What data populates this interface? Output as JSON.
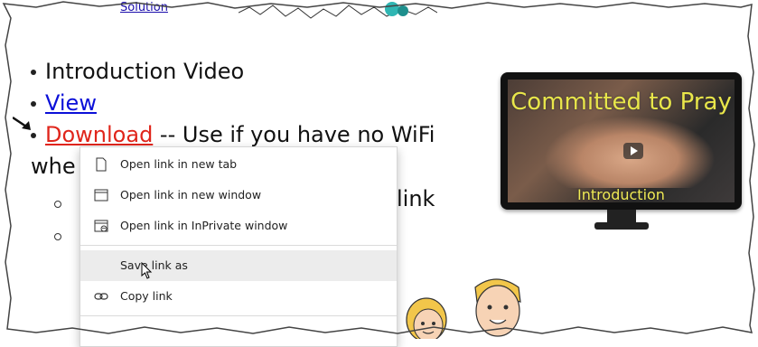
{
  "top_link": "Solution",
  "list": {
    "item1": "Introduction Video",
    "item2_link": "View",
    "item3_link": "Download",
    "item3_text": " -- Use if you have no WiFi",
    "item4_text": "whe",
    "sub_tail": "link"
  },
  "video": {
    "title": "Committed to Pray",
    "subtitle": "Introduction"
  },
  "context_menu": {
    "items": [
      {
        "label": "Open link in new tab",
        "icon": "new-tab-icon"
      },
      {
        "label": "Open link in new window",
        "icon": "new-window-icon"
      },
      {
        "label": "Open link in InPrivate window",
        "icon": "inprivate-window-icon"
      },
      {
        "label": "Save link as",
        "icon": "none",
        "hovered": true
      },
      {
        "label": "Copy link",
        "icon": "link-icon"
      }
    ]
  },
  "colors": {
    "view_link": "#0b10d8",
    "download_link": "#e0251b",
    "video_title": "#e9e64a",
    "menu_hover": "#ececec"
  }
}
